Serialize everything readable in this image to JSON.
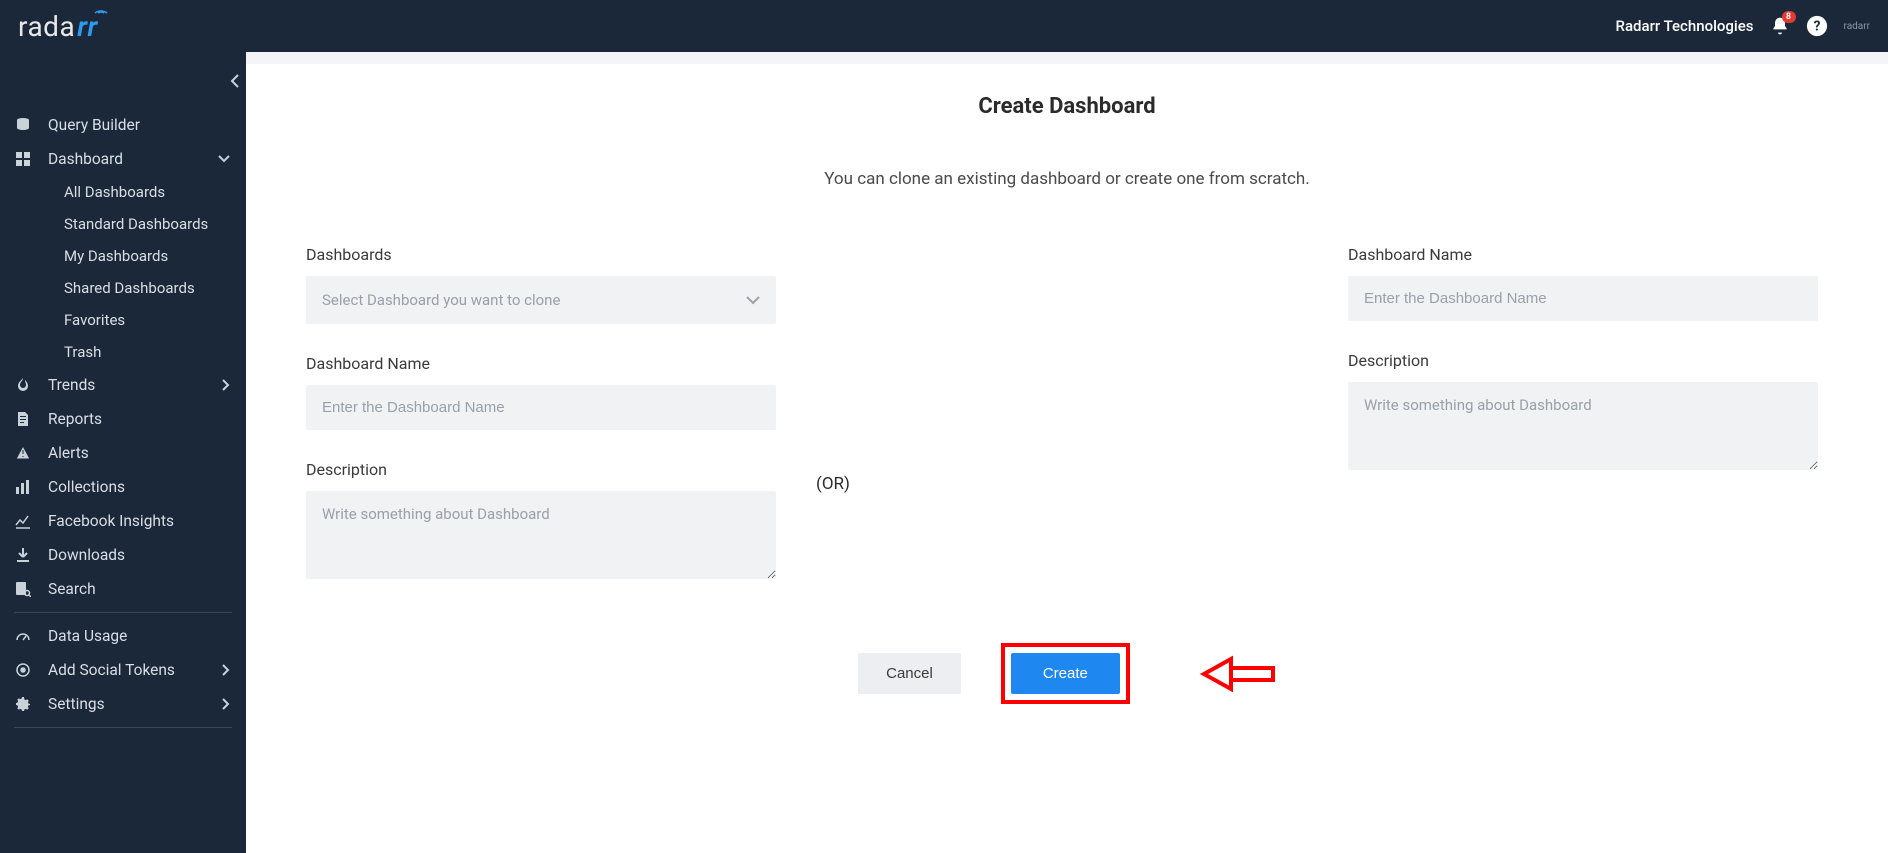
{
  "header": {
    "logo_base": "rada",
    "logo_tail": "rr",
    "org_name": "Radarr Technologies",
    "notif_count": "8",
    "small_logo": "radarr"
  },
  "sidebar": {
    "items": [
      {
        "id": "query-builder",
        "label": "Query Builder"
      },
      {
        "id": "dashboard",
        "label": "Dashboard",
        "expandable": true,
        "expanded": true
      },
      {
        "id": "trends",
        "label": "Trends",
        "expandable": true
      },
      {
        "id": "reports",
        "label": "Reports"
      },
      {
        "id": "alerts",
        "label": "Alerts"
      },
      {
        "id": "collections",
        "label": "Collections"
      },
      {
        "id": "facebook-insights",
        "label": "Facebook Insights"
      },
      {
        "id": "downloads",
        "label": "Downloads"
      },
      {
        "id": "search",
        "label": "Search"
      },
      {
        "id": "data-usage",
        "label": "Data Usage"
      },
      {
        "id": "add-social-tokens",
        "label": "Add Social Tokens",
        "expandable": true
      },
      {
        "id": "settings",
        "label": "Settings",
        "expandable": true
      }
    ],
    "dashboard_sub": [
      "All Dashboards",
      "Standard Dashboards",
      "My Dashboards",
      "Shared Dashboards",
      "Favorites",
      "Trash"
    ]
  },
  "page": {
    "title": "Create Dashboard",
    "subtitle": "You can clone an existing dashboard or create one from scratch.",
    "or_text": "(OR)"
  },
  "left": {
    "dashboards_label": "Dashboards",
    "dashboards_placeholder": "Select Dashboard you want to clone",
    "name_label": "Dashboard Name",
    "name_placeholder": "Enter the Dashboard Name",
    "desc_label": "Description",
    "desc_placeholder": "Write something about Dashboard"
  },
  "right": {
    "name_label": "Dashboard Name",
    "name_placeholder": "Enter the Dashboard Name",
    "desc_label": "Description",
    "desc_placeholder": "Write something about Dashboard"
  },
  "actions": {
    "cancel": "Cancel",
    "create": "Create"
  }
}
